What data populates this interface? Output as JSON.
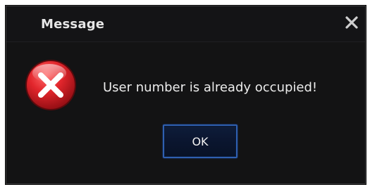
{
  "dialog": {
    "title": "Message",
    "message": "User number is already occupied!",
    "ok_label": "OK",
    "close_icon": "close-icon",
    "status_icon": "error-icon"
  },
  "colors": {
    "background": "#131314",
    "title_text": "#e6e6e6",
    "error_red": "#d8242a",
    "button_border": "#2f5fb0"
  }
}
